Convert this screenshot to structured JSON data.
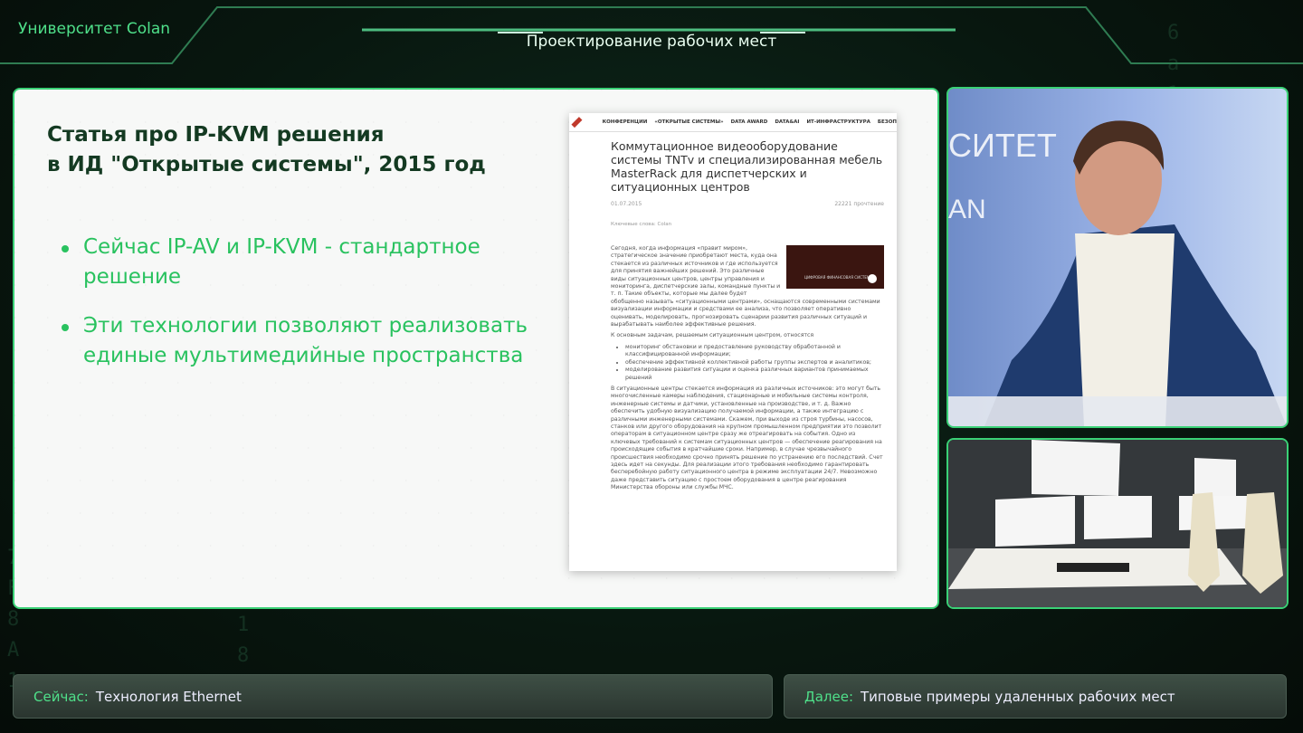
{
  "brand": "Университет Colan",
  "header": {
    "title": "Проектирование рабочих мест"
  },
  "slide": {
    "title": "Статья про IP-KVM решения\nв ИД \"Открытые системы\", 2015 год",
    "bullets": [
      "Сейчас IP-AV и IP-KVM - стандартное решение",
      "Эти технологии позволяют реализовать единые мультимедийные пространства"
    ],
    "article": {
      "nav": [
        "КОНФЕРЕНЦИИ",
        "«ОТКРЫТЫЕ СИСТЕМЫ»",
        "DATA AWARD",
        "DATA&AI",
        "ИТ-ИНФРАСТРУКТУРА",
        "БЕЗОП"
      ],
      "headline": "Коммутационное видеооборудование системы TNTv и специализированная мебель MasterRack для диспетчерских и ситуационных центров",
      "date": "01.07.2015",
      "views": "22221 прочтение",
      "tags": "Ключевые слова: Colan",
      "intro": "Сегодня, когда информация «правит миром», стратегическое значение приобретают места, куда она стекается из различных источников и где используется для принятия важнейших решений. Это различные виды ситуационных центров, центры управления и мониторинга, диспетчерские залы, командные пункты и т. п. Такие объекты, которые мы далее будет обобщенно называть «ситуационными центрами», оснащаются современными системами визуализации информации и средствами ее анализа, что позволяет оперативно оценивать, моделировать, прогнозировать сценарии развития различных ситуаций и вырабатывать наиболее эффективные решения.",
      "tasks_intro": "К основным задачам, решаемым ситуационным центром, относятся",
      "tasks": [
        "мониторинг обстановки и предоставление руководству обработанной и классифицированной информации;",
        "обеспечение эффективной коллективной работы группы экспертов и аналитиков;",
        "моделирование развития ситуации и оценка различных вариантов принимаемых решений"
      ],
      "body": "В ситуационные центры стекается информация из различных источников: это могут быть многочисленные камеры наблюдения, стационарные и мобильные системы контроля, инженерные системы и датчики, установленные на производстве, и т. д. Важно обеспечить удобную визуализацию получаемой информации, а также интеграцию с различными инженерными системами. Скажем, при выходе из строя турбины, насосов, станков или другого оборудования на крупном промышленном предприятии это позволит операторам в ситуационном центре сразу же отреагировать на события. Одно из ключевых требований к системам ситуационных центров — обеспечение реагирования на происходящие события в кратчайшие сроки. Например, в случае чрезвычайного происшествия необходимо срочно принять решение по устранению его последствий. Счет здесь идет на секунды. Для реализации этого требования необходимо гарантировать бесперебойную работу ситуационного центра в режиме эксплуатации 24/7. Невозможно даже представить ситуацию с простоем оборудования в центре реагирования Министерства обороны или службы МЧС.",
      "image_caption": "ЦИФРОВАЯ ФИНАНСОВАЯ СИСТЕМА"
    }
  },
  "footer": {
    "now_label": "Сейчас:",
    "now_value": "Технология Ethernet",
    "next_label": "Далее:",
    "next_value": "Типовые примеры удаленных рабочих мест"
  },
  "colors": {
    "accent": "#3ad176",
    "text_green": "#29c25f",
    "title_dark": "#143a22"
  }
}
